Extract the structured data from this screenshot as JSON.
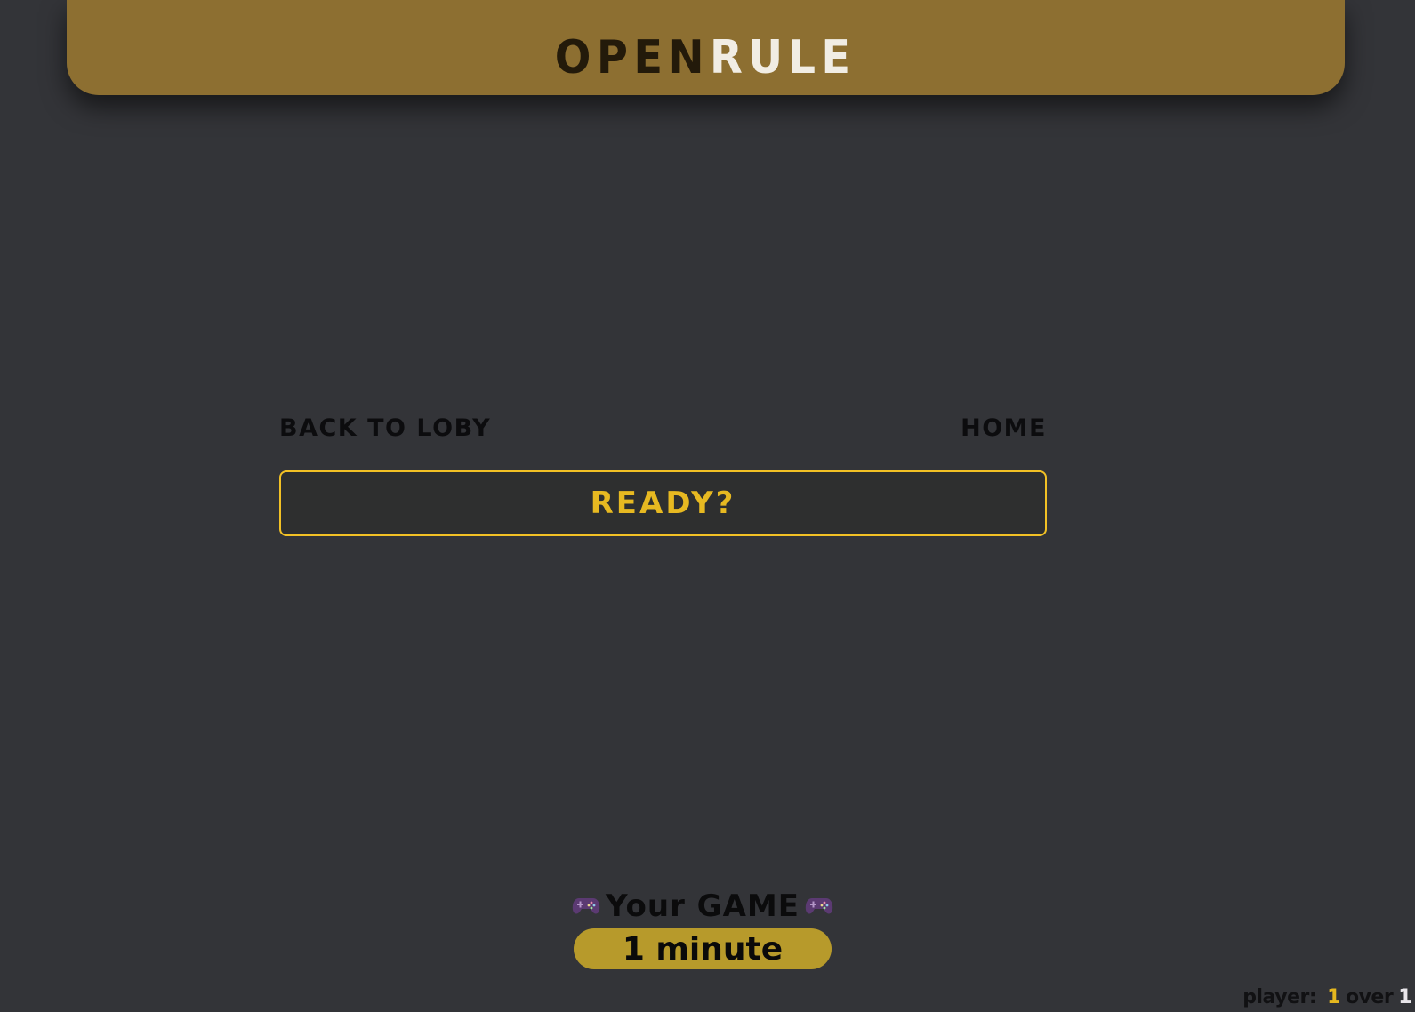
{
  "header": {
    "logo_part1": "OPEN",
    "logo_part2": "RULE"
  },
  "nav": {
    "back_label": "BACK TO LOBY",
    "home_label": "HOME"
  },
  "ready_button": {
    "label": "READY?"
  },
  "game": {
    "title": "Your GAME",
    "icon": "game-controller-icon",
    "duration": "1 minute"
  },
  "players": {
    "label": "player:",
    "current": "1",
    "separator": "over",
    "total": "1"
  },
  "colors": {
    "background": "#333438",
    "header": "#8d6f31",
    "accent_yellow": "#f2c125",
    "pill": "#b79a2b",
    "controller": "#5b3a72"
  }
}
